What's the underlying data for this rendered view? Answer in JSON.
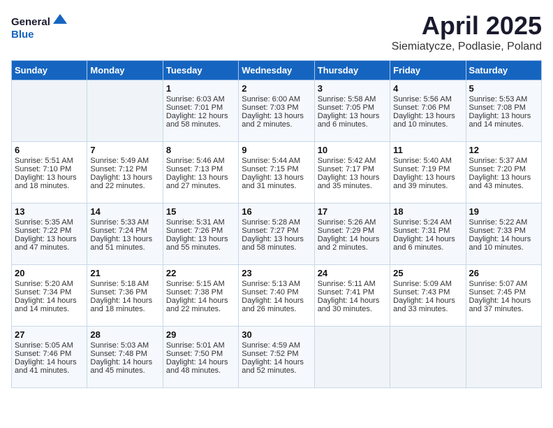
{
  "header": {
    "logo_line1": "General",
    "logo_line2": "Blue",
    "month_title": "April 2025",
    "subtitle": "Siemiatycze, Podlasie, Poland"
  },
  "weekdays": [
    "Sunday",
    "Monday",
    "Tuesday",
    "Wednesday",
    "Thursday",
    "Friday",
    "Saturday"
  ],
  "weeks": [
    [
      {
        "day": "",
        "content": ""
      },
      {
        "day": "",
        "content": ""
      },
      {
        "day": "1",
        "content": "Sunrise: 6:03 AM\nSunset: 7:01 PM\nDaylight: 12 hours\nand 58 minutes."
      },
      {
        "day": "2",
        "content": "Sunrise: 6:00 AM\nSunset: 7:03 PM\nDaylight: 13 hours\nand 2 minutes."
      },
      {
        "day": "3",
        "content": "Sunrise: 5:58 AM\nSunset: 7:05 PM\nDaylight: 13 hours\nand 6 minutes."
      },
      {
        "day": "4",
        "content": "Sunrise: 5:56 AM\nSunset: 7:06 PM\nDaylight: 13 hours\nand 10 minutes."
      },
      {
        "day": "5",
        "content": "Sunrise: 5:53 AM\nSunset: 7:08 PM\nDaylight: 13 hours\nand 14 minutes."
      }
    ],
    [
      {
        "day": "6",
        "content": "Sunrise: 5:51 AM\nSunset: 7:10 PM\nDaylight: 13 hours\nand 18 minutes."
      },
      {
        "day": "7",
        "content": "Sunrise: 5:49 AM\nSunset: 7:12 PM\nDaylight: 13 hours\nand 22 minutes."
      },
      {
        "day": "8",
        "content": "Sunrise: 5:46 AM\nSunset: 7:13 PM\nDaylight: 13 hours\nand 27 minutes."
      },
      {
        "day": "9",
        "content": "Sunrise: 5:44 AM\nSunset: 7:15 PM\nDaylight: 13 hours\nand 31 minutes."
      },
      {
        "day": "10",
        "content": "Sunrise: 5:42 AM\nSunset: 7:17 PM\nDaylight: 13 hours\nand 35 minutes."
      },
      {
        "day": "11",
        "content": "Sunrise: 5:40 AM\nSunset: 7:19 PM\nDaylight: 13 hours\nand 39 minutes."
      },
      {
        "day": "12",
        "content": "Sunrise: 5:37 AM\nSunset: 7:20 PM\nDaylight: 13 hours\nand 43 minutes."
      }
    ],
    [
      {
        "day": "13",
        "content": "Sunrise: 5:35 AM\nSunset: 7:22 PM\nDaylight: 13 hours\nand 47 minutes."
      },
      {
        "day": "14",
        "content": "Sunrise: 5:33 AM\nSunset: 7:24 PM\nDaylight: 13 hours\nand 51 minutes."
      },
      {
        "day": "15",
        "content": "Sunrise: 5:31 AM\nSunset: 7:26 PM\nDaylight: 13 hours\nand 55 minutes."
      },
      {
        "day": "16",
        "content": "Sunrise: 5:28 AM\nSunset: 7:27 PM\nDaylight: 13 hours\nand 58 minutes."
      },
      {
        "day": "17",
        "content": "Sunrise: 5:26 AM\nSunset: 7:29 PM\nDaylight: 14 hours\nand 2 minutes."
      },
      {
        "day": "18",
        "content": "Sunrise: 5:24 AM\nSunset: 7:31 PM\nDaylight: 14 hours\nand 6 minutes."
      },
      {
        "day": "19",
        "content": "Sunrise: 5:22 AM\nSunset: 7:33 PM\nDaylight: 14 hours\nand 10 minutes."
      }
    ],
    [
      {
        "day": "20",
        "content": "Sunrise: 5:20 AM\nSunset: 7:34 PM\nDaylight: 14 hours\nand 14 minutes."
      },
      {
        "day": "21",
        "content": "Sunrise: 5:18 AM\nSunset: 7:36 PM\nDaylight: 14 hours\nand 18 minutes."
      },
      {
        "day": "22",
        "content": "Sunrise: 5:15 AM\nSunset: 7:38 PM\nDaylight: 14 hours\nand 22 minutes."
      },
      {
        "day": "23",
        "content": "Sunrise: 5:13 AM\nSunset: 7:40 PM\nDaylight: 14 hours\nand 26 minutes."
      },
      {
        "day": "24",
        "content": "Sunrise: 5:11 AM\nSunset: 7:41 PM\nDaylight: 14 hours\nand 30 minutes."
      },
      {
        "day": "25",
        "content": "Sunrise: 5:09 AM\nSunset: 7:43 PM\nDaylight: 14 hours\nand 33 minutes."
      },
      {
        "day": "26",
        "content": "Sunrise: 5:07 AM\nSunset: 7:45 PM\nDaylight: 14 hours\nand 37 minutes."
      }
    ],
    [
      {
        "day": "27",
        "content": "Sunrise: 5:05 AM\nSunset: 7:46 PM\nDaylight: 14 hours\nand 41 minutes."
      },
      {
        "day": "28",
        "content": "Sunrise: 5:03 AM\nSunset: 7:48 PM\nDaylight: 14 hours\nand 45 minutes."
      },
      {
        "day": "29",
        "content": "Sunrise: 5:01 AM\nSunset: 7:50 PM\nDaylight: 14 hours\nand 48 minutes."
      },
      {
        "day": "30",
        "content": "Sunrise: 4:59 AM\nSunset: 7:52 PM\nDaylight: 14 hours\nand 52 minutes."
      },
      {
        "day": "",
        "content": ""
      },
      {
        "day": "",
        "content": ""
      },
      {
        "day": "",
        "content": ""
      }
    ]
  ]
}
